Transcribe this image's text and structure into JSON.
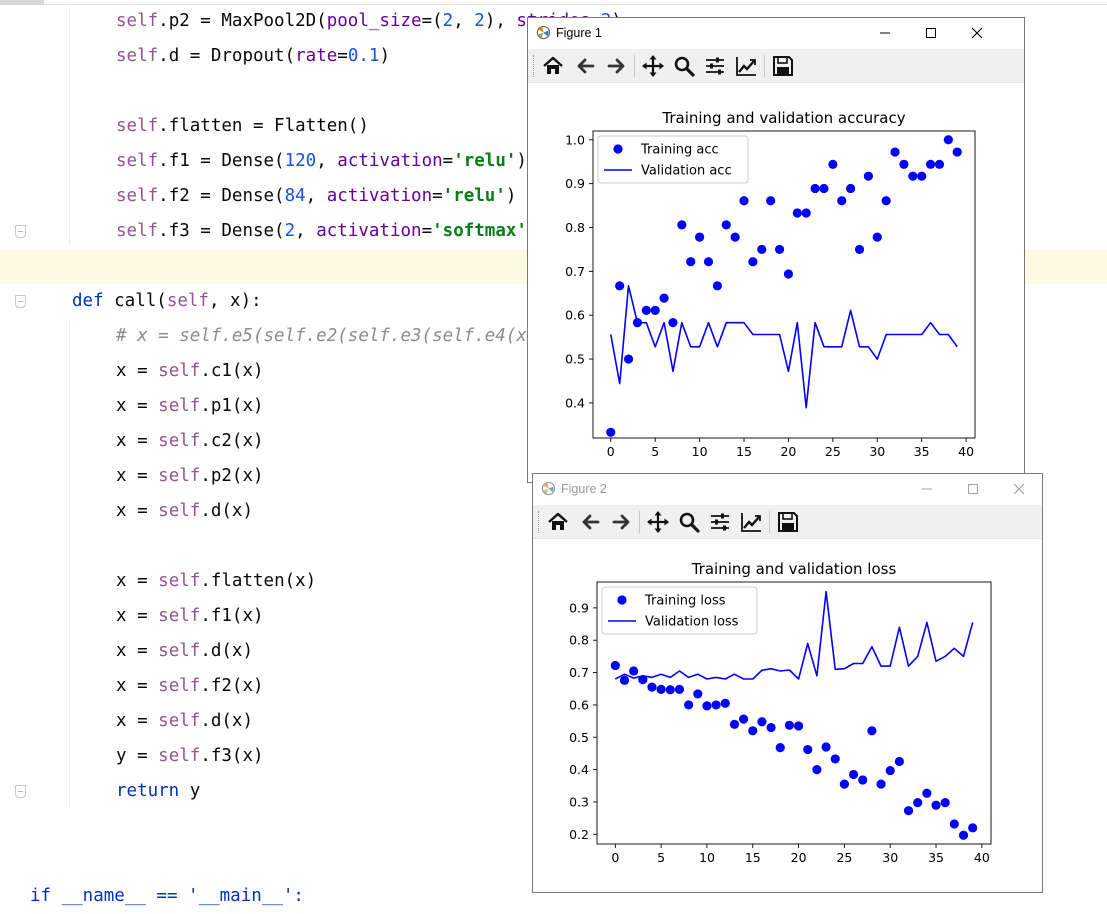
{
  "editor": {
    "lines": [
      {
        "y": 0,
        "x": 116,
        "tokens": [
          [
            "self",
            "kw-self"
          ],
          [
            ".p2 = MaxPool2D(",
            ""
          ],
          [
            "pool_size",
            "kw-param"
          ],
          [
            "=(",
            ""
          ],
          [
            "2",
            "num"
          ],
          [
            ", ",
            ""
          ],
          [
            "2",
            "num"
          ],
          [
            "), ",
            ""
          ],
          [
            "strides",
            "kw-param"
          ],
          [
            "=",
            ""
          ],
          [
            "2",
            "num"
          ],
          [
            ")",
            ""
          ]
        ]
      },
      {
        "y": 1,
        "x": 116,
        "tokens": [
          [
            "self",
            "kw-self"
          ],
          [
            ".d = Dropout(",
            ""
          ],
          [
            "rate",
            "kw-param"
          ],
          [
            "=",
            ""
          ],
          [
            "0.1",
            "num"
          ],
          [
            ")",
            ""
          ]
        ]
      },
      {
        "y": 3,
        "x": 116,
        "tokens": [
          [
            "self",
            "kw-self"
          ],
          [
            ".flatten = Flatten()",
            ""
          ]
        ]
      },
      {
        "y": 4,
        "x": 116,
        "tokens": [
          [
            "self",
            "kw-self"
          ],
          [
            ".f1 = Dense(",
            ""
          ],
          [
            "120",
            "num"
          ],
          [
            ", ",
            ""
          ],
          [
            "activation",
            "kw-param"
          ],
          [
            "=",
            ""
          ],
          [
            "'relu'",
            "str"
          ],
          [
            ")",
            ""
          ]
        ]
      },
      {
        "y": 5,
        "x": 116,
        "tokens": [
          [
            "self",
            "kw-self"
          ],
          [
            ".f2 = Dense(",
            ""
          ],
          [
            "84",
            "num"
          ],
          [
            ", ",
            ""
          ],
          [
            "activation",
            "kw-param"
          ],
          [
            "=",
            ""
          ],
          [
            "'relu'",
            "str"
          ],
          [
            ")",
            ""
          ]
        ]
      },
      {
        "y": 6,
        "x": 116,
        "tokens": [
          [
            "self",
            "kw-self"
          ],
          [
            ".f3 = Dense(",
            ""
          ],
          [
            "2",
            "num"
          ],
          [
            ", ",
            ""
          ],
          [
            "activation",
            "kw-param"
          ],
          [
            "=",
            ""
          ],
          [
            "'softmax'",
            "str"
          ],
          [
            ")",
            ""
          ]
        ]
      },
      {
        "y": 8,
        "x": 72,
        "tokens": [
          [
            "def",
            "kw-def"
          ],
          [
            " call(",
            ""
          ],
          [
            "self",
            "kw-self"
          ],
          [
            ", x):",
            ""
          ]
        ]
      },
      {
        "y": 9,
        "x": 116,
        "tokens": [
          [
            "# x = self.e5(self.e2(self.e3(self.e4(x))))",
            "cmt"
          ]
        ]
      },
      {
        "y": 10,
        "x": 116,
        "tokens": [
          [
            "x = ",
            ""
          ],
          [
            "self",
            "kw-self"
          ],
          [
            ".c1(x)",
            ""
          ]
        ]
      },
      {
        "y": 11,
        "x": 116,
        "tokens": [
          [
            "x = ",
            ""
          ],
          [
            "self",
            "kw-self"
          ],
          [
            ".p1(x)",
            ""
          ]
        ]
      },
      {
        "y": 12,
        "x": 116,
        "tokens": [
          [
            "x = ",
            ""
          ],
          [
            "self",
            "kw-self"
          ],
          [
            ".c2(x)",
            ""
          ]
        ]
      },
      {
        "y": 13,
        "x": 116,
        "tokens": [
          [
            "x = ",
            ""
          ],
          [
            "self",
            "kw-self"
          ],
          [
            ".p2(x)",
            ""
          ]
        ]
      },
      {
        "y": 14,
        "x": 116,
        "tokens": [
          [
            "x = ",
            ""
          ],
          [
            "self",
            "kw-self"
          ],
          [
            ".d(x)",
            ""
          ]
        ]
      },
      {
        "y": 16,
        "x": 116,
        "tokens": [
          [
            "x = ",
            ""
          ],
          [
            "self",
            "kw-self"
          ],
          [
            ".flatten(x)",
            ""
          ]
        ]
      },
      {
        "y": 17,
        "x": 116,
        "tokens": [
          [
            "x = ",
            ""
          ],
          [
            "self",
            "kw-self"
          ],
          [
            ".f1(x)",
            ""
          ]
        ]
      },
      {
        "y": 18,
        "x": 116,
        "tokens": [
          [
            "x = ",
            ""
          ],
          [
            "self",
            "kw-self"
          ],
          [
            ".d(x)",
            ""
          ]
        ]
      },
      {
        "y": 19,
        "x": 116,
        "tokens": [
          [
            "x = ",
            ""
          ],
          [
            "self",
            "kw-self"
          ],
          [
            ".f2(x)",
            ""
          ]
        ]
      },
      {
        "y": 20,
        "x": 116,
        "tokens": [
          [
            "x = ",
            ""
          ],
          [
            "self",
            "kw-self"
          ],
          [
            ".d(x)",
            ""
          ]
        ]
      },
      {
        "y": 21,
        "x": 116,
        "tokens": [
          [
            "y = ",
            ""
          ],
          [
            "self",
            "kw-self"
          ],
          [
            ".f3(x)",
            ""
          ]
        ]
      },
      {
        "y": 22,
        "x": 116,
        "tokens": [
          [
            "return",
            "kw-def"
          ],
          [
            " y",
            ""
          ]
        ]
      },
      {
        "y": 25,
        "x": 30,
        "tokens": [
          [
            "if __name__ == '__main__':",
            "kw-def"
          ]
        ]
      }
    ]
  },
  "windows": [
    {
      "id": "figure1",
      "title": "Figure 1",
      "active": true
    },
    {
      "id": "figure2",
      "title": "Figure 2",
      "active": false
    }
  ],
  "toolbar_icons": [
    "home-icon",
    "back-arrow-icon",
    "forward-arrow-icon",
    "pan-icon",
    "zoom-icon",
    "configure-subplots-icon",
    "edit-axis-icon",
    "save-icon"
  ],
  "chart_data": [
    {
      "type": "scatter",
      "title": "Training and validation accuracy",
      "xlabel": "",
      "ylabel": "",
      "xlim": [
        -2,
        41
      ],
      "ylim": [
        0.32,
        1.02
      ],
      "xticks": [
        0,
        5,
        10,
        15,
        20,
        25,
        30,
        35,
        40
      ],
      "yticks": [
        0.4,
        0.5,
        0.6,
        0.7,
        0.8,
        0.9,
        1.0
      ],
      "ytick_labels": [
        "0.4",
        "0.5",
        "0.6",
        "0.7",
        "0.8",
        "0.9",
        "1.0"
      ],
      "legend_position": "upper-left",
      "color": "#0000ff",
      "series": [
        {
          "name": "Training acc",
          "kind": "points",
          "x": [
            0,
            1,
            2,
            3,
            4,
            5,
            6,
            7,
            8,
            9,
            10,
            11,
            12,
            13,
            14,
            15,
            16,
            17,
            18,
            19,
            20,
            21,
            22,
            23,
            24,
            25,
            26,
            27,
            28,
            29,
            30,
            31,
            32,
            33,
            34,
            35,
            36,
            37,
            38,
            39
          ],
          "values": [
            0.333,
            0.667,
            0.5,
            0.583,
            0.611,
            0.611,
            0.639,
            0.583,
            0.806,
            0.722,
            0.778,
            0.722,
            0.667,
            0.806,
            0.778,
            0.861,
            0.722,
            0.75,
            0.861,
            0.75,
            0.694,
            0.833,
            0.833,
            0.889,
            0.889,
            0.944,
            0.861,
            0.889,
            0.75,
            0.917,
            0.778,
            0.861,
            0.972,
            0.944,
            0.917,
            0.917,
            0.944,
            0.944,
            1.0,
            0.972
          ]
        },
        {
          "name": "Validation acc",
          "kind": "line",
          "x": [
            0,
            1,
            2,
            3,
            4,
            5,
            6,
            7,
            8,
            9,
            10,
            11,
            12,
            13,
            14,
            15,
            16,
            17,
            18,
            19,
            20,
            21,
            22,
            23,
            24,
            25,
            26,
            27,
            28,
            29,
            30,
            31,
            32,
            33,
            34,
            35,
            36,
            37,
            38,
            39
          ],
          "values": [
            0.556,
            0.444,
            0.667,
            0.583,
            0.583,
            0.528,
            0.583,
            0.472,
            0.583,
            0.528,
            0.528,
            0.583,
            0.528,
            0.583,
            0.583,
            0.583,
            0.556,
            0.556,
            0.556,
            0.556,
            0.472,
            0.583,
            0.389,
            0.583,
            0.528,
            0.528,
            0.528,
            0.611,
            0.528,
            0.528,
            0.5,
            0.556,
            0.556,
            0.556,
            0.556,
            0.556,
            0.583,
            0.556,
            0.556,
            0.528
          ]
        }
      ]
    },
    {
      "type": "scatter",
      "title": "Training and validation loss",
      "xlabel": "",
      "ylabel": "",
      "xlim": [
        -2,
        41
      ],
      "ylim": [
        0.17,
        0.98
      ],
      "xticks": [
        0,
        5,
        10,
        15,
        20,
        25,
        30,
        35,
        40
      ],
      "yticks": [
        0.2,
        0.3,
        0.4,
        0.5,
        0.6,
        0.7,
        0.8,
        0.9
      ],
      "ytick_labels": [
        "0.2",
        "0.3",
        "0.4",
        "0.5",
        "0.6",
        "0.7",
        "0.8",
        "0.9"
      ],
      "legend_position": "upper-left",
      "color": "#0000ff",
      "series": [
        {
          "name": "Training loss",
          "kind": "points",
          "x": [
            0,
            1,
            2,
            3,
            4,
            5,
            6,
            7,
            8,
            9,
            10,
            11,
            12,
            13,
            14,
            15,
            16,
            17,
            18,
            19,
            20,
            21,
            22,
            23,
            24,
            25,
            26,
            27,
            28,
            29,
            30,
            31,
            32,
            33,
            34,
            35,
            36,
            37,
            38,
            39
          ],
          "values": [
            0.722,
            0.676,
            0.705,
            0.678,
            0.655,
            0.648,
            0.647,
            0.648,
            0.6,
            0.634,
            0.597,
            0.6,
            0.605,
            0.54,
            0.556,
            0.52,
            0.548,
            0.53,
            0.468,
            0.537,
            0.535,
            0.462,
            0.4,
            0.47,
            0.433,
            0.355,
            0.385,
            0.368,
            0.52,
            0.355,
            0.397,
            0.425,
            0.273,
            0.298,
            0.327,
            0.29,
            0.298,
            0.232,
            0.197,
            0.22
          ]
        },
        {
          "name": "Validation loss",
          "kind": "line",
          "x": [
            0,
            1,
            2,
            3,
            4,
            5,
            6,
            7,
            8,
            9,
            10,
            11,
            12,
            13,
            14,
            15,
            16,
            17,
            18,
            19,
            20,
            21,
            22,
            23,
            24,
            25,
            26,
            27,
            28,
            29,
            30,
            31,
            32,
            33,
            34,
            35,
            36,
            37,
            38,
            39
          ],
          "values": [
            0.68,
            0.695,
            0.683,
            0.69,
            0.685,
            0.695,
            0.685,
            0.705,
            0.685,
            0.695,
            0.68,
            0.685,
            0.68,
            0.695,
            0.68,
            0.68,
            0.707,
            0.712,
            0.705,
            0.708,
            0.68,
            0.79,
            0.69,
            0.95,
            0.71,
            0.712,
            0.728,
            0.728,
            0.78,
            0.72,
            0.72,
            0.84,
            0.72,
            0.75,
            0.855,
            0.735,
            0.75,
            0.775,
            0.75,
            0.855
          ]
        }
      ]
    }
  ]
}
